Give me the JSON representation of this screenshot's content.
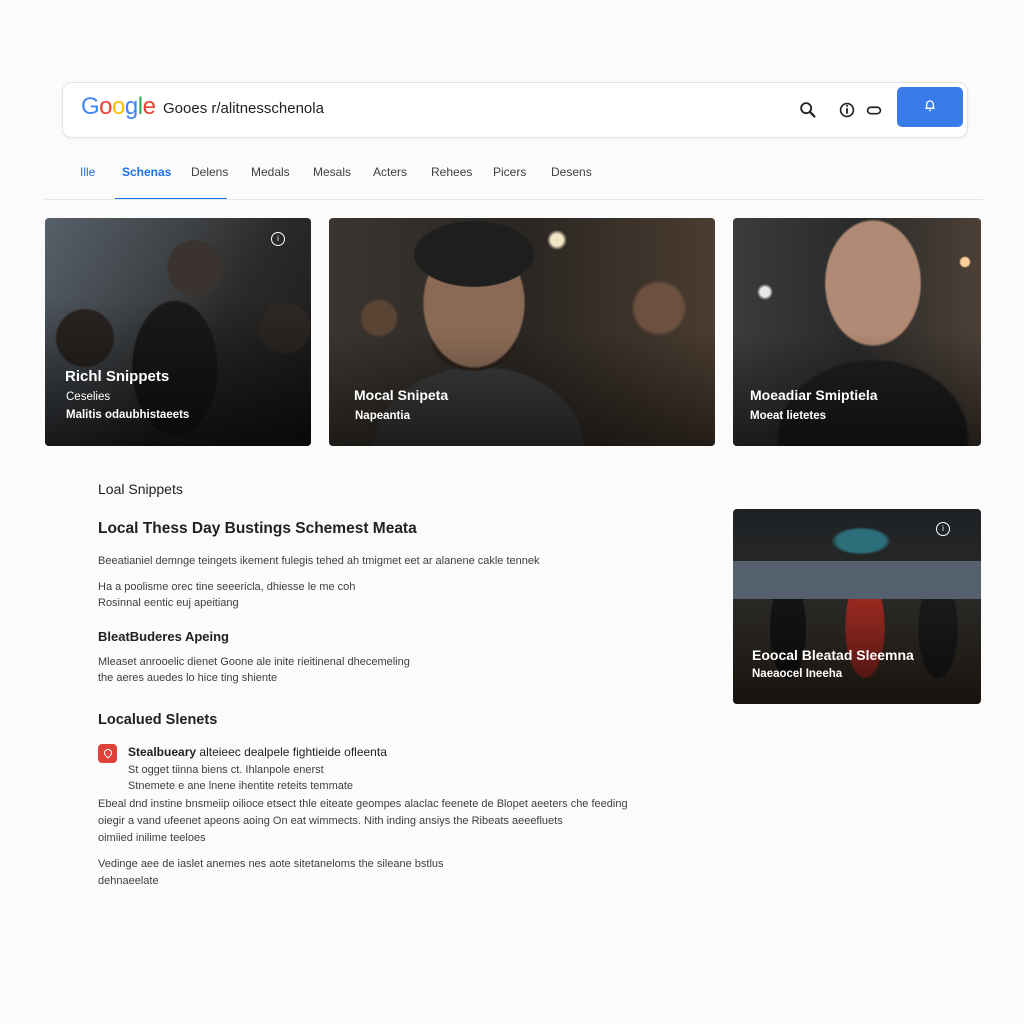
{
  "search": {
    "logo_letters": [
      "G",
      "o",
      "o",
      "g",
      "l",
      "e"
    ],
    "logo_colors": [
      "#4285F4",
      "#EA4335",
      "#FBBC05",
      "#4285F4",
      "#34A853",
      "#EA4335"
    ],
    "query": "Gooes r/alitnesschenola",
    "accent": "#3a7bea"
  },
  "tabs": [
    "Ille",
    "Schenas",
    "Delens",
    "Medals",
    "Mesals",
    "Acters",
    "Rehees",
    "Picers",
    "Desens"
  ],
  "cards": [
    {
      "title": "Richl Snippets",
      "line1": "Ceselies",
      "line2": "Malitis odaubhistaeets",
      "badge": "i"
    },
    {
      "title": "Mocal Snipeta",
      "line1": "Napeantia"
    },
    {
      "title": "Moeadiar Smiptiela",
      "line1": "Moeat lietetes"
    },
    {
      "title": "Eoocal Bleatad Sleemna",
      "line1": "Naeaocel Ineeha",
      "badge": "i"
    }
  ],
  "body": {
    "section_label": "Loal Snippets",
    "heading": "Local Thess Day Bustings Schemest Meata",
    "para1": "Beeatianiel demnge teingets ikement fulegis tehed ah tmigmet eet ar alanene cakle tennek",
    "para2_l1": "Ha a poolisme orec tine seeericla, dhiesse le me coh",
    "para2_l2": "Rosinnal eentic euj apeitiang",
    "sub_heading": "BleatBuderes Apeing",
    "para3_l1": "Mleaset anrooelic dienet Goone ale inite rieitinenal dhecemeling",
    "para3_l2": "the aeres auedes lo hice ting shiente",
    "heading2": "Localued Slenets",
    "listing_title": "Stealbueary",
    "listing_title_rest": "alteieec dealpele fightieide ofleenta",
    "listing_l1": "St ogget tiinna biens ct. Ihlanpole enerst",
    "listing_l2": "Stnemete e ane lnene ihentite reteits temmate",
    "para4_l1": "Ebeal dnd instine bnsmeiip oilioce etsect thle eiteate geompes alaclac feenete de Blopet aeeters che feeding",
    "para4_l2": "oiegir a vand ufeenet apeons aoing On eat wimmects. Nith inding ansiys the Ribeats aeeefluets",
    "para4_l3": "oimiied inilime teeloes",
    "para5_l1": "Vedinge aee de iaslet anemes nes aote sitetaneloms the sileane bstlus",
    "para5_l2": "dehnaeelate"
  }
}
